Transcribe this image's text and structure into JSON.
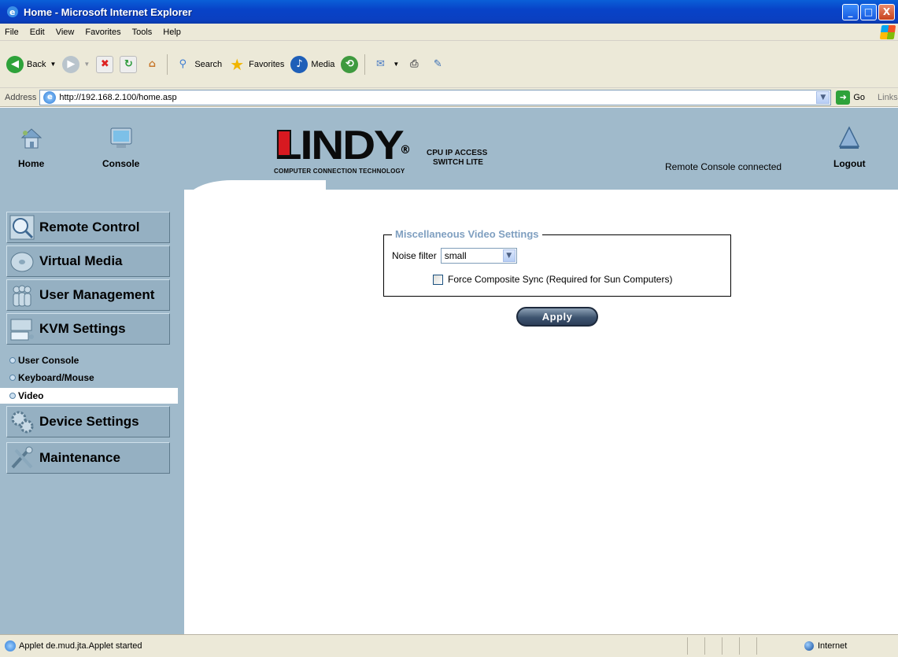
{
  "window": {
    "title": "Home - Microsoft Internet Explorer",
    "min": "_",
    "max": "□",
    "close": "X"
  },
  "menu": [
    "File",
    "Edit",
    "View",
    "Favorites",
    "Tools",
    "Help"
  ],
  "toolbar": {
    "back": "Back",
    "search": "Search",
    "favorites": "Favorites",
    "media": "Media"
  },
  "address": {
    "label": "Address",
    "url": "http://192.168.2.100/home.asp",
    "go": "Go",
    "links": "Links"
  },
  "header": {
    "home_label": "Home",
    "console_label": "Console",
    "logout_label": "Logout",
    "status": "Remote Console connected",
    "logo": {
      "brand": "LINDY",
      "registered": "®",
      "tagline": "COMPUTER CONNECTION TECHNOLOGY",
      "product_line1": "CPU IP ACCESS",
      "product_line2": "SWITCH LITE"
    }
  },
  "sidebar": {
    "items": [
      {
        "label": "Remote Control"
      },
      {
        "label": "Virtual Media"
      },
      {
        "label": "User Management"
      },
      {
        "label": "KVM Settings"
      },
      {
        "label": "Device Settings"
      },
      {
        "label": "Maintenance"
      }
    ],
    "subitems": [
      {
        "label": "User Console",
        "selected": false
      },
      {
        "label": "Keyboard/Mouse",
        "selected": false
      },
      {
        "label": "Video",
        "selected": true
      }
    ]
  },
  "settings": {
    "legend": "Miscellaneous Video Settings",
    "noise_label": "Noise filter",
    "noise_value": "small",
    "force_sync_label": "Force Composite Sync (Required for Sun Computers)",
    "force_sync_checked": false,
    "apply_label": "Apply"
  },
  "status_bar": {
    "message": "Applet de.mud.jta.Applet started",
    "zone": "Internet"
  },
  "colors": {
    "panel_bg": "#a0bacb",
    "nav_button": "#95b0c2",
    "legend_text": "#7f9fc0",
    "title_blue": "#0843c8"
  }
}
